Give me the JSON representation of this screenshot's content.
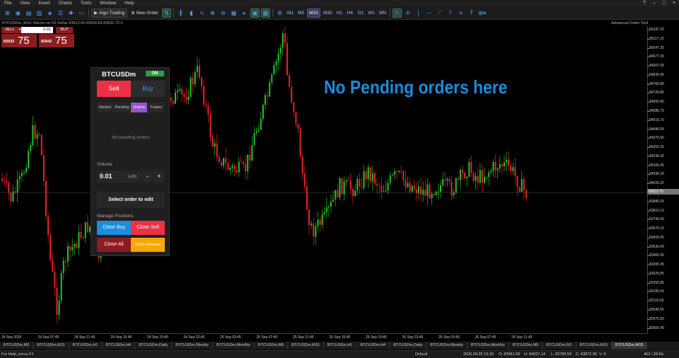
{
  "menu": [
    "File",
    "View",
    "Insert",
    "Charts",
    "Tools",
    "Window",
    "Help"
  ],
  "window_controls": [
    "?",
    "–",
    "□",
    "×"
  ],
  "toolbar": {
    "algo_label": "Algo Trading",
    "new_order_label": "New Order",
    "timeframes": [
      "M1",
      "M5",
      "M15",
      "M30",
      "H1",
      "H4",
      "D1",
      "W1",
      "MN"
    ],
    "active_timeframe": "M15"
  },
  "symbol_info": "BTCUSDm, M15:  Bitcoin vs US Dollar  83913.59 83934.69 83932.75 0",
  "advanced_tool_label": "Advanced Order Tool",
  "one_click": {
    "sell_label": "SELL",
    "buy_label": "BUY",
    "volume": "0.01",
    "bid_small": "83932",
    "bid_big": "75",
    "ask_small": "83942",
    "ask_big": "75"
  },
  "y_axis": [
    "85187.25",
    "85117.15",
    "85047.35",
    "84977.35",
    "84907.00",
    "84836.95",
    "84766.80",
    "84726.85",
    "84656.80",
    "84586.75",
    "84516.70",
    "84446.55",
    "84376.50",
    "84306.35",
    "84236.30",
    "84166.45",
    "84096.30",
    "84026.25",
    "83956.20",
    "83886.25",
    "83816.10",
    "83746.00",
    "83676.10",
    "83606.05",
    "83536.00",
    "83465.95",
    "83395.95",
    "83325.85",
    "83255.85",
    "83185.65",
    "83115.55",
    "83045.55",
    "82975.60",
    "82905.40"
  ],
  "current_price": "83932.75",
  "x_axis": [
    "24 Sep 2026",
    "24 Sep 07:45",
    "24 Sep 11:45",
    "24 Sep 15:45",
    "24 Sep 19:45",
    "24 Sep 22:45",
    "25 Sep 03:45",
    "25 Sep 07:45",
    "25 Sep 11:45",
    "25 Sep 15:45",
    "25 Sep 19:45",
    "25 Sep 23:45",
    "26 Sep 03:45",
    "26 Sep 07:45",
    "26 Sep 11:45"
  ],
  "chart_tabs": [
    "BTCUSDm,M5",
    "BTCUSDm,M15",
    "BTCUSDm,H1",
    "BTCUSDm,H4",
    "BTCUSDm,Daily",
    "BTCUSDm,Weekly",
    "BTCUSDm,Monthly",
    "BTCUSDm,M5",
    "BTCUSDm,M15",
    "BTCUSDm,H1",
    "BTCUSDm,H4",
    "BTCUSDm,Daily",
    "BTCUSDm,Weekly",
    "BTCUSDm,Monthly",
    "BTCUSDm,M5",
    "BTCUSDm,M1",
    "BTCUSDm,M15",
    "BTCUSDm,M15"
  ],
  "active_tab_index": 17,
  "status": {
    "help": "For Help, press F1",
    "profile": "Default",
    "time": "2026.09.25 16:30",
    "open": "O: 83961.66",
    "high": "H: 84027.14",
    "low": "L: 83785.59",
    "close": "C: 83872.95",
    "volume": "V: 0",
    "traffic": "463 / 28 Kb"
  },
  "panel": {
    "title": "BTCUSDm",
    "on_label": "ON",
    "sell": "Sell",
    "buy": "Buy",
    "tabs": [
      "Market",
      "Pending",
      "Orders",
      "Trades"
    ],
    "active_tab": "Orders",
    "empty_text": "No pending orders",
    "volume_label": "Volume",
    "volume_value": "0.01",
    "lots_label": "Lots",
    "minus": "-",
    "plus": "+",
    "select_label": "Select order to edit",
    "manage_label": "Manage Positions",
    "close_buy": "Close Buy",
    "close_sell": "Close Sell",
    "close_all": "Close All",
    "close_pending": "Close Pending"
  },
  "headline": "No Pending orders here",
  "colors": {
    "bull": "#22c52a",
    "bear": "#e8232b",
    "accent": "#1a8ddb"
  }
}
